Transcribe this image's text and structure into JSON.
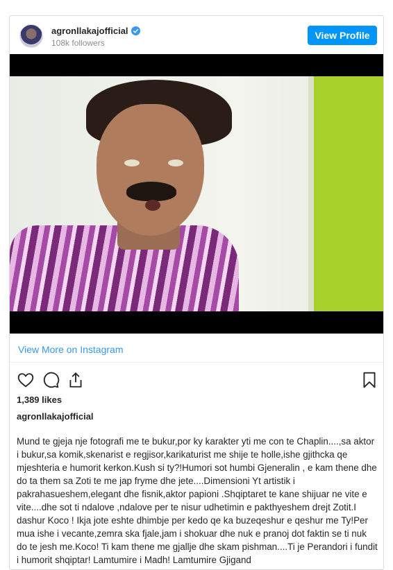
{
  "post": {
    "username": "agronllakajofficial",
    "followers": "108k followers",
    "view_profile_label": "View Profile",
    "view_more_label": "View More on Instagram",
    "likes": "1,389 likes",
    "caption_user": "agronllakajofficial",
    "caption_text": "Mund te gjeja nje fotografi me te bukur,por ky karakter yti me con te Chaplin....,sa aktor i bukur,sa komik,skenarist e regjisor,karikaturist me shije te holle,ishe gjithcka qe mjeshteria e humorit kerkon.Kush si ty?!Humori sot humbi Gjeneralin , e kam thene dhe do ta them sa Zoti te me jap fryme dhe jete....Dimensioni Yt artistik i pakrahasueshem,elegant dhe fisnik,aktor papioni .Shqiptaret te kane shijuar ne vite e vite....dhe sot ti ndalove ,ndalove per te nisur udhetimin e pakthyeshem drejt Zotit.I dashur Koco ! Ikja jote eshte dhimbje per kedo qe ka buzeqeshur e qeshur me Ty!Per mua ishe i vecante,zemra ska fjale,jam i shokuar dhe nuk e pranoj dot faktin se ti nuk do te jesh me.Koco! Ti kam thene me gjallje dhe skam pishman....Ti je Perandori i fundit i humorit shqiptar! Lamtumire i Madh! Lamtumire Gjigand"
  },
  "icons": {
    "verified": "verified-badge-icon",
    "like": "heart-icon",
    "comment": "comment-icon",
    "share": "share-icon",
    "save": "bookmark-icon"
  },
  "colors": {
    "accent": "#0095f6",
    "link": "#3897f0",
    "muted": "#8e8e8e",
    "text": "#262626"
  }
}
